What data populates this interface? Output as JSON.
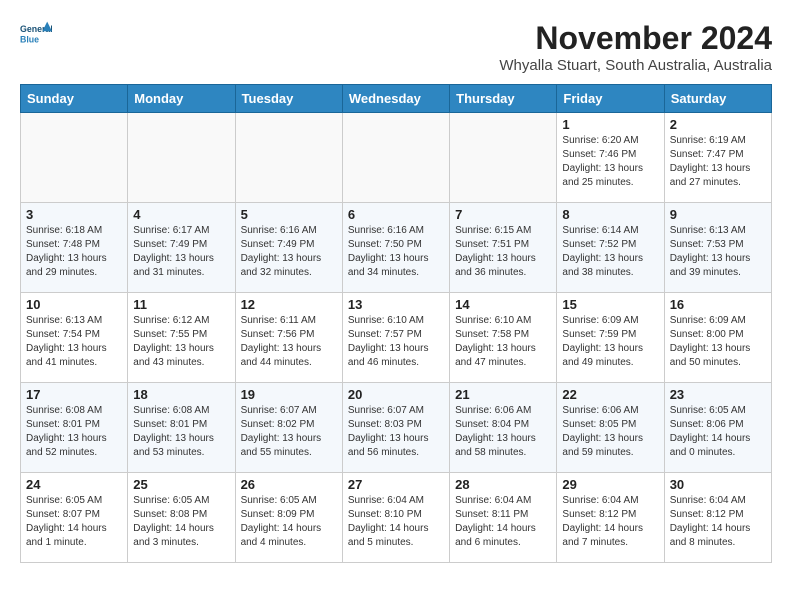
{
  "header": {
    "logo_line1": "General",
    "logo_line2": "Blue",
    "month_title": "November 2024",
    "subtitle": "Whyalla Stuart, South Australia, Australia"
  },
  "weekdays": [
    "Sunday",
    "Monday",
    "Tuesday",
    "Wednesday",
    "Thursday",
    "Friday",
    "Saturday"
  ],
  "weeks": [
    [
      {
        "day": "",
        "info": ""
      },
      {
        "day": "",
        "info": ""
      },
      {
        "day": "",
        "info": ""
      },
      {
        "day": "",
        "info": ""
      },
      {
        "day": "",
        "info": ""
      },
      {
        "day": "1",
        "info": "Sunrise: 6:20 AM\nSunset: 7:46 PM\nDaylight: 13 hours\nand 25 minutes."
      },
      {
        "day": "2",
        "info": "Sunrise: 6:19 AM\nSunset: 7:47 PM\nDaylight: 13 hours\nand 27 minutes."
      }
    ],
    [
      {
        "day": "3",
        "info": "Sunrise: 6:18 AM\nSunset: 7:48 PM\nDaylight: 13 hours\nand 29 minutes."
      },
      {
        "day": "4",
        "info": "Sunrise: 6:17 AM\nSunset: 7:49 PM\nDaylight: 13 hours\nand 31 minutes."
      },
      {
        "day": "5",
        "info": "Sunrise: 6:16 AM\nSunset: 7:49 PM\nDaylight: 13 hours\nand 32 minutes."
      },
      {
        "day": "6",
        "info": "Sunrise: 6:16 AM\nSunset: 7:50 PM\nDaylight: 13 hours\nand 34 minutes."
      },
      {
        "day": "7",
        "info": "Sunrise: 6:15 AM\nSunset: 7:51 PM\nDaylight: 13 hours\nand 36 minutes."
      },
      {
        "day": "8",
        "info": "Sunrise: 6:14 AM\nSunset: 7:52 PM\nDaylight: 13 hours\nand 38 minutes."
      },
      {
        "day": "9",
        "info": "Sunrise: 6:13 AM\nSunset: 7:53 PM\nDaylight: 13 hours\nand 39 minutes."
      }
    ],
    [
      {
        "day": "10",
        "info": "Sunrise: 6:13 AM\nSunset: 7:54 PM\nDaylight: 13 hours\nand 41 minutes."
      },
      {
        "day": "11",
        "info": "Sunrise: 6:12 AM\nSunset: 7:55 PM\nDaylight: 13 hours\nand 43 minutes."
      },
      {
        "day": "12",
        "info": "Sunrise: 6:11 AM\nSunset: 7:56 PM\nDaylight: 13 hours\nand 44 minutes."
      },
      {
        "day": "13",
        "info": "Sunrise: 6:10 AM\nSunset: 7:57 PM\nDaylight: 13 hours\nand 46 minutes."
      },
      {
        "day": "14",
        "info": "Sunrise: 6:10 AM\nSunset: 7:58 PM\nDaylight: 13 hours\nand 47 minutes."
      },
      {
        "day": "15",
        "info": "Sunrise: 6:09 AM\nSunset: 7:59 PM\nDaylight: 13 hours\nand 49 minutes."
      },
      {
        "day": "16",
        "info": "Sunrise: 6:09 AM\nSunset: 8:00 PM\nDaylight: 13 hours\nand 50 minutes."
      }
    ],
    [
      {
        "day": "17",
        "info": "Sunrise: 6:08 AM\nSunset: 8:01 PM\nDaylight: 13 hours\nand 52 minutes."
      },
      {
        "day": "18",
        "info": "Sunrise: 6:08 AM\nSunset: 8:01 PM\nDaylight: 13 hours\nand 53 minutes."
      },
      {
        "day": "19",
        "info": "Sunrise: 6:07 AM\nSunset: 8:02 PM\nDaylight: 13 hours\nand 55 minutes."
      },
      {
        "day": "20",
        "info": "Sunrise: 6:07 AM\nSunset: 8:03 PM\nDaylight: 13 hours\nand 56 minutes."
      },
      {
        "day": "21",
        "info": "Sunrise: 6:06 AM\nSunset: 8:04 PM\nDaylight: 13 hours\nand 58 minutes."
      },
      {
        "day": "22",
        "info": "Sunrise: 6:06 AM\nSunset: 8:05 PM\nDaylight: 13 hours\nand 59 minutes."
      },
      {
        "day": "23",
        "info": "Sunrise: 6:05 AM\nSunset: 8:06 PM\nDaylight: 14 hours\nand 0 minutes."
      }
    ],
    [
      {
        "day": "24",
        "info": "Sunrise: 6:05 AM\nSunset: 8:07 PM\nDaylight: 14 hours\nand 1 minute."
      },
      {
        "day": "25",
        "info": "Sunrise: 6:05 AM\nSunset: 8:08 PM\nDaylight: 14 hours\nand 3 minutes."
      },
      {
        "day": "26",
        "info": "Sunrise: 6:05 AM\nSunset: 8:09 PM\nDaylight: 14 hours\nand 4 minutes."
      },
      {
        "day": "27",
        "info": "Sunrise: 6:04 AM\nSunset: 8:10 PM\nDaylight: 14 hours\nand 5 minutes."
      },
      {
        "day": "28",
        "info": "Sunrise: 6:04 AM\nSunset: 8:11 PM\nDaylight: 14 hours\nand 6 minutes."
      },
      {
        "day": "29",
        "info": "Sunrise: 6:04 AM\nSunset: 8:12 PM\nDaylight: 14 hours\nand 7 minutes."
      },
      {
        "day": "30",
        "info": "Sunrise: 6:04 AM\nSunset: 8:12 PM\nDaylight: 14 hours\nand 8 minutes."
      }
    ]
  ]
}
